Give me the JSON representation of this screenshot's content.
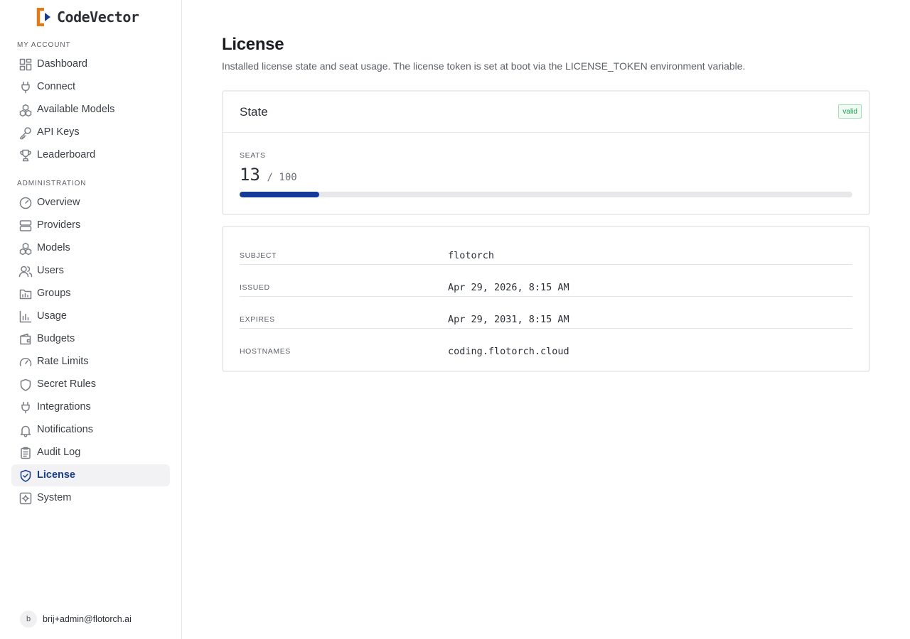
{
  "brand": {
    "name": "CodeVector",
    "logo_colors": {
      "orange": "#e07b1a",
      "blue": "#1a3e8f"
    }
  },
  "sidebar": {
    "sections": [
      {
        "label": "MY ACCOUNT",
        "items": [
          {
            "label": "Dashboard",
            "icon": "dashboard-icon"
          },
          {
            "label": "Connect",
            "icon": "plug-icon"
          },
          {
            "label": "Available Models",
            "icon": "cubes-icon"
          },
          {
            "label": "API Keys",
            "icon": "key-icon"
          },
          {
            "label": "Leaderboard",
            "icon": "trophy-icon"
          }
        ]
      },
      {
        "label": "ADMINISTRATION",
        "items": [
          {
            "label": "Overview",
            "icon": "gauge-icon"
          },
          {
            "label": "Providers",
            "icon": "server-icon"
          },
          {
            "label": "Models",
            "icon": "cubes-icon"
          },
          {
            "label": "Users",
            "icon": "users-icon"
          },
          {
            "label": "Groups",
            "icon": "folder-icon"
          },
          {
            "label": "Usage",
            "icon": "bar-chart-icon"
          },
          {
            "label": "Budgets",
            "icon": "wallet-icon"
          },
          {
            "label": "Rate Limits",
            "icon": "speedometer-icon"
          },
          {
            "label": "Secret Rules",
            "icon": "shield-icon"
          },
          {
            "label": "Integrations",
            "icon": "plug-icon"
          },
          {
            "label": "Notifications",
            "icon": "bell-icon"
          },
          {
            "label": "Audit Log",
            "icon": "clipboard-icon"
          },
          {
            "label": "License",
            "icon": "shield-check-icon",
            "active": true
          },
          {
            "label": "System",
            "icon": "settings-icon"
          }
        ]
      }
    ],
    "user": {
      "initial": "b",
      "email": "brij+admin@flotorch.ai"
    }
  },
  "page": {
    "title": "License",
    "description": "Installed license state and seat usage. The license token is set at boot via the LICENSE_TOKEN environment variable."
  },
  "state_card": {
    "title": "State",
    "badge": "valid",
    "seats_label": "SEATS",
    "seats_used": "13",
    "seats_total": "/ 100",
    "seats_fraction": 0.13,
    "colors": {
      "progress_fill": "#173a9a",
      "badge_text": "#1f9d55"
    }
  },
  "details": [
    {
      "key": "SUBJECT",
      "value": "flotorch"
    },
    {
      "key": "ISSUED",
      "value": "Apr 29, 2026, 8:15 AM"
    },
    {
      "key": "EXPIRES",
      "value": "Apr 29, 2031, 8:15 AM"
    },
    {
      "key": "HOSTNAMES",
      "value": "coding.flotorch.cloud"
    }
  ]
}
